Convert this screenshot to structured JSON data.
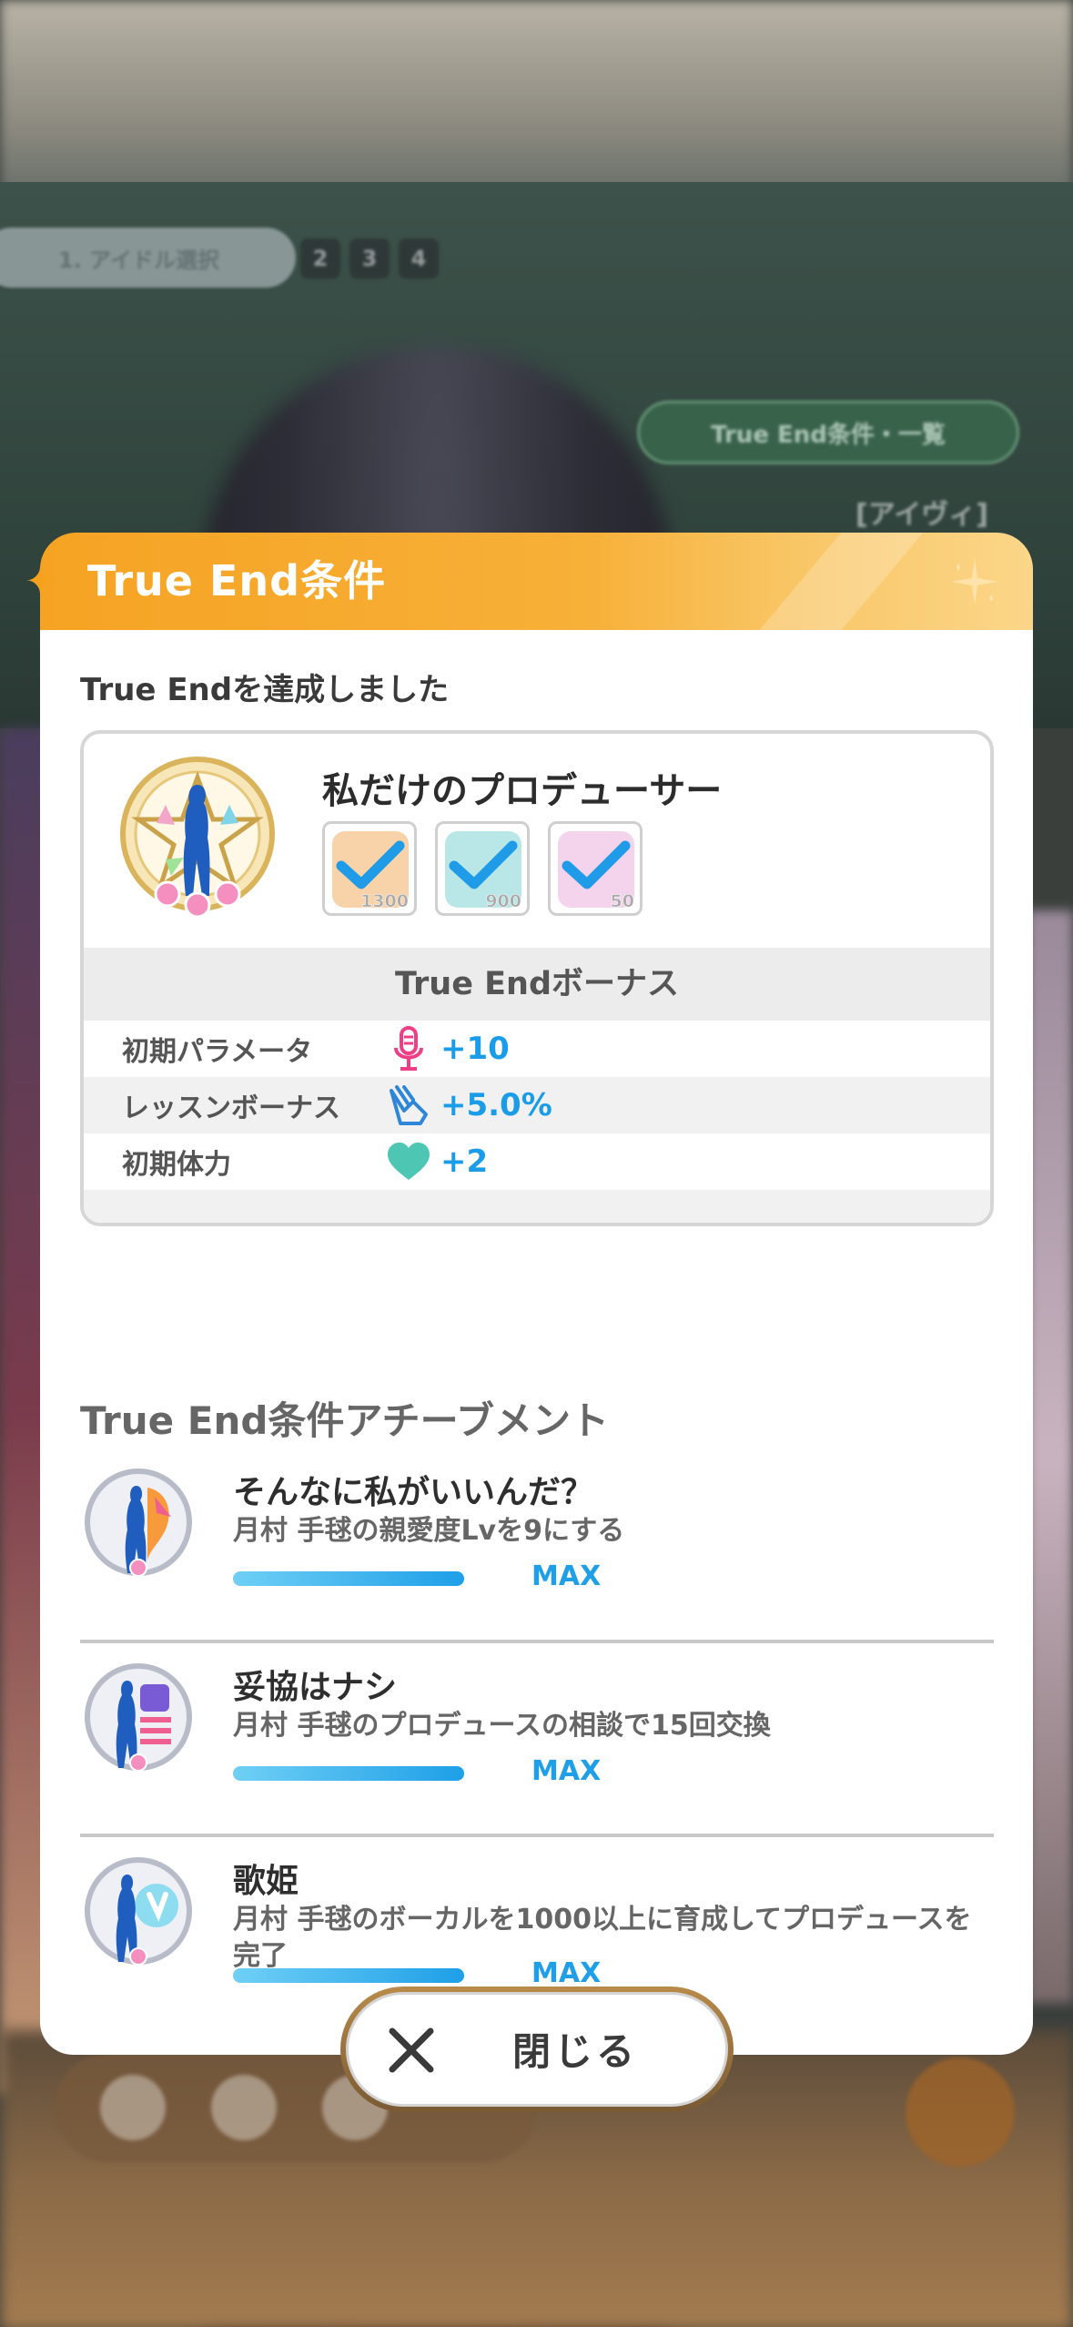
{
  "background": {
    "idol_select_pill": "1. アイドル選択",
    "steps": [
      "2",
      "3",
      "4"
    ],
    "true_end_condition_pill": "True End条件・一覧",
    "aside_label": "[アイヴィ]"
  },
  "modal": {
    "title": "True End条件",
    "achieved_text": "True Endを達成しました",
    "card": {
      "title": "私だけのプロデューサー",
      "requirements": [
        {
          "icon": "vocal-ticket-icon",
          "value": "1300",
          "color": "#f5c58f"
        },
        {
          "icon": "dance-badge-icon",
          "value": "900",
          "color": "#a7e1e0"
        },
        {
          "icon": "visual-notes-icon",
          "value": "50",
          "color": "#f2c7e6"
        }
      ],
      "bonus_header": "True Endボーナス",
      "bonuses": [
        {
          "label": "初期パラメータ",
          "icon": "microphone-icon",
          "value": "+10"
        },
        {
          "label": "レッスンボーナス",
          "icon": "lesson-hand-icon",
          "value": "+5.0%"
        },
        {
          "label": "初期体力",
          "icon": "heart-icon",
          "value": "+2"
        }
      ]
    },
    "achievements_heading": "True End条件アチーブメント",
    "achievements": [
      {
        "title": "そんなに私がいいんだ？",
        "description": "月村 手毬の親愛度Lvを9にする",
        "status": "MAX",
        "progress": 1.0,
        "icon": "affection-emblem-icon"
      },
      {
        "title": "妥協はナシ",
        "description": "月村 手毬のプロデュースの相談で15回交換",
        "status": "MAX",
        "progress": 1.0,
        "icon": "consult-emblem-icon"
      },
      {
        "title": "歌姫",
        "description": "月村 手毬のボーカルを1000以上に育成してプロデュースを完了",
        "status": "MAX",
        "progress": 1.0,
        "icon": "vocal-emblem-icon"
      }
    ],
    "close_label": "閉じる"
  },
  "colors": {
    "header_orange": "#f6a323",
    "accent_blue": "#1a9ce8",
    "heart_teal": "#4ec6b4",
    "mic_pink": "#ee3f86"
  }
}
